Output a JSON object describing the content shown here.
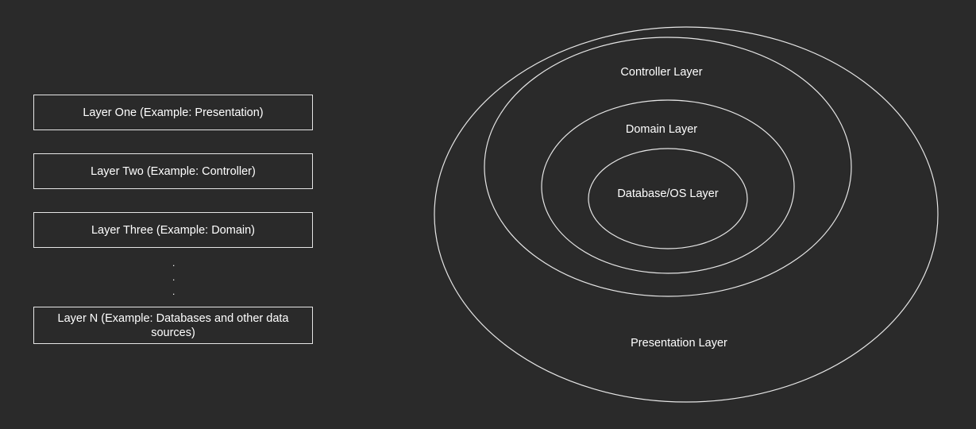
{
  "layers_list": {
    "items": [
      {
        "label": "Layer One (Example: Presentation)"
      },
      {
        "label": "Layer Two (Example: Controller)"
      },
      {
        "label": "Layer Three (Example: Domain)"
      },
      {
        "label": "Layer N (Example: Databases and other data sources)"
      }
    ],
    "ellipsis": [
      ".",
      ".",
      "."
    ]
  },
  "onion_diagram": {
    "presentation_label": "Presentation Layer",
    "controller_label": "Controller Layer",
    "domain_label": "Domain Layer",
    "database_label": "Database/OS Layer"
  },
  "colors": {
    "background": "#2a2a2a",
    "stroke": "#e6e6e6",
    "text": "#ffffff"
  }
}
